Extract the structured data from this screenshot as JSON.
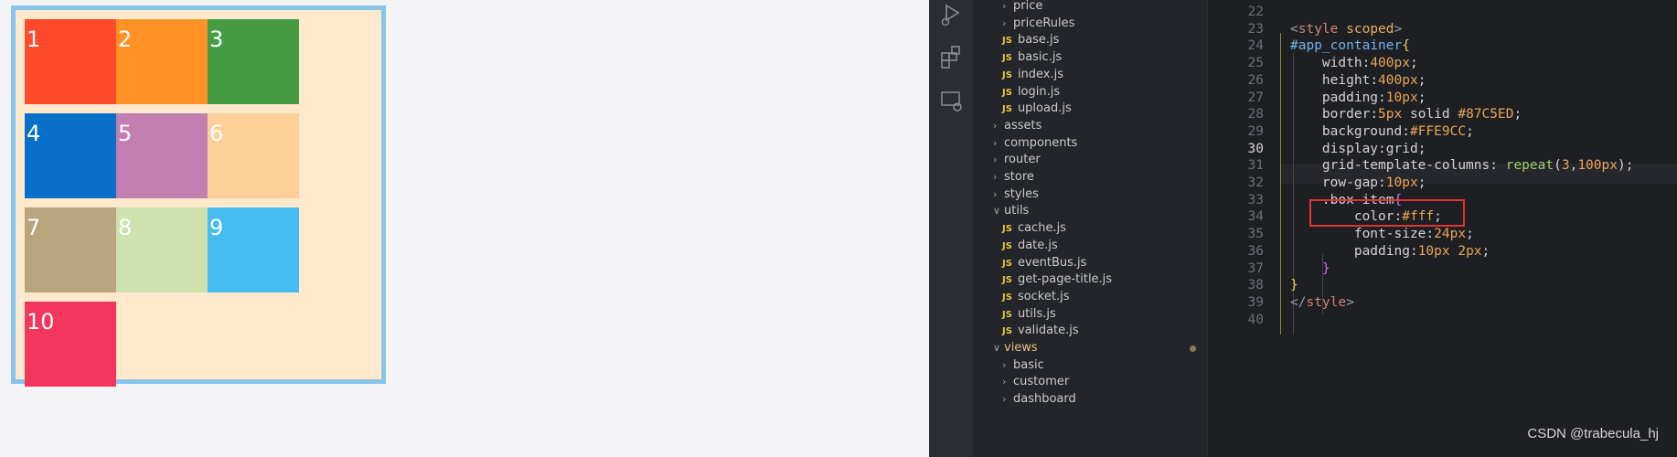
{
  "preview": {
    "items": [
      {
        "label": "1",
        "color": "#FF4B2B"
      },
      {
        "label": "2",
        "color": "#FF9125"
      },
      {
        "label": "3",
        "color": "#459C43"
      },
      {
        "label": "4",
        "color": "#0870C8"
      },
      {
        "label": "5",
        "color": "#C37FB1"
      },
      {
        "label": "6",
        "color": "#FDD09A"
      },
      {
        "label": "7",
        "color": "#B8A57E"
      },
      {
        "label": "8",
        "color": "#CFE1AC"
      },
      {
        "label": "9",
        "color": "#45BDF0"
      },
      {
        "label": "10",
        "color": "#F4355D"
      }
    ]
  },
  "explorer": {
    "items": [
      {
        "type": "folder",
        "label": "price",
        "indent": 1,
        "open": false
      },
      {
        "type": "folder",
        "label": "priceRules",
        "indent": 1,
        "open": false
      },
      {
        "type": "file",
        "label": "base.js",
        "indent": 1
      },
      {
        "type": "file",
        "label": "basic.js",
        "indent": 1
      },
      {
        "type": "file",
        "label": "index.js",
        "indent": 1
      },
      {
        "type": "file",
        "label": "login.js",
        "indent": 1
      },
      {
        "type": "file",
        "label": "upload.js",
        "indent": 1
      },
      {
        "type": "folder",
        "label": "assets",
        "indent": 0,
        "open": false
      },
      {
        "type": "folder",
        "label": "components",
        "indent": 0,
        "open": false
      },
      {
        "type": "folder",
        "label": "router",
        "indent": 0,
        "open": false
      },
      {
        "type": "folder",
        "label": "store",
        "indent": 0,
        "open": false
      },
      {
        "type": "folder",
        "label": "styles",
        "indent": 0,
        "open": false
      },
      {
        "type": "folder",
        "label": "utils",
        "indent": 0,
        "open": true
      },
      {
        "type": "file",
        "label": "cache.js",
        "indent": 1
      },
      {
        "type": "file",
        "label": "date.js",
        "indent": 1
      },
      {
        "type": "file",
        "label": "eventBus.js",
        "indent": 1
      },
      {
        "type": "file",
        "label": "get-page-title.js",
        "indent": 1
      },
      {
        "type": "file",
        "label": "socket.js",
        "indent": 1
      },
      {
        "type": "file",
        "label": "utils.js",
        "indent": 1
      },
      {
        "type": "file",
        "label": "validate.js",
        "indent": 1
      },
      {
        "type": "folder",
        "label": "views",
        "indent": 0,
        "open": true,
        "modified": true
      },
      {
        "type": "folder",
        "label": "basic",
        "indent": 1,
        "open": false
      },
      {
        "type": "folder",
        "label": "customer",
        "indent": 1,
        "open": false
      },
      {
        "type": "folder",
        "label": "dashboard",
        "indent": 1,
        "open": false
      }
    ]
  },
  "code": {
    "active_line": "30",
    "lines": [
      {
        "n": "22",
        "t": ""
      },
      {
        "n": "23",
        "t": "<style scoped>"
      },
      {
        "n": "24",
        "t": "#app_container{"
      },
      {
        "n": "25",
        "t": "    width:400px;"
      },
      {
        "n": "26",
        "t": "    height:400px;"
      },
      {
        "n": "27",
        "t": "    padding:10px;"
      },
      {
        "n": "28",
        "t": "    border:5px solid #87C5ED;"
      },
      {
        "n": "29",
        "t": "    background:#FFE9CC;"
      },
      {
        "n": "30",
        "t": "    display:grid;"
      },
      {
        "n": "31",
        "t": "    grid-template-columns: repeat(3,100px);"
      },
      {
        "n": "32",
        "t": "    row-gap:10px;"
      },
      {
        "n": "33",
        "t": "    .box-item{"
      },
      {
        "n": "34",
        "t": "        color:#fff;"
      },
      {
        "n": "35",
        "t": "        font-size:24px;"
      },
      {
        "n": "36",
        "t": "        padding:10px 2px;"
      },
      {
        "n": "37",
        "t": "    }"
      },
      {
        "n": "38",
        "t": "}"
      },
      {
        "n": "39",
        "t": "</style>"
      },
      {
        "n": "40",
        "t": ""
      }
    ]
  },
  "watermark": "CSDN @trabecula_hj"
}
